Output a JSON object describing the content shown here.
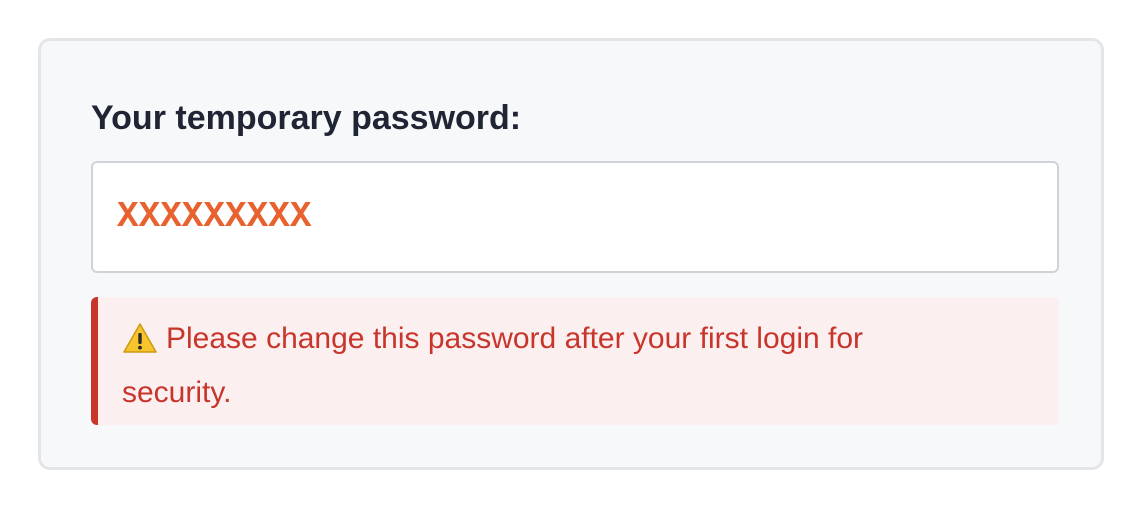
{
  "panel": {
    "heading": "Your temporary password:",
    "password_value": "XXXXXXXXX",
    "warning": {
      "icon": "warning-icon",
      "text": "Please change this password after your first login for security."
    }
  },
  "colors": {
    "heading": "#1f2533",
    "password": "#e8622f",
    "warning_text": "#c8352b",
    "warning_bg": "#fbefef",
    "card_bg": "#f7f8fa",
    "card_border": "#e3e5e8"
  }
}
